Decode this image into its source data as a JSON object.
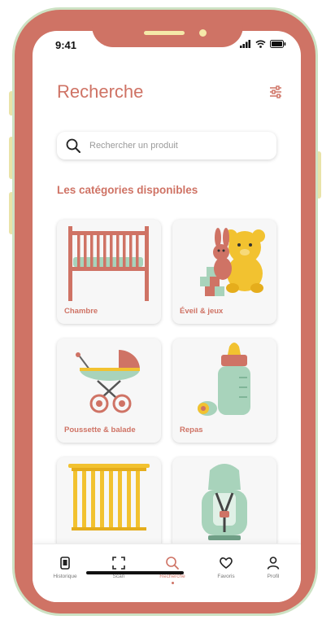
{
  "status_bar": {
    "time": "9:41"
  },
  "header": {
    "title": "Recherche"
  },
  "search": {
    "placeholder": "Rechercher un produit"
  },
  "section": {
    "title": "Les catégories disponibles"
  },
  "categories": [
    {
      "label": "Chambre",
      "icon": "crib-icon"
    },
    {
      "label": "Éveil & jeux",
      "icon": "teddy-bear-icon"
    },
    {
      "label": "Poussette & balade",
      "icon": "stroller-icon"
    },
    {
      "label": "Repas",
      "icon": "baby-bottle-icon"
    },
    {
      "label": "",
      "icon": "safety-gate-icon"
    },
    {
      "label": "",
      "icon": "car-seat-icon"
    }
  ],
  "tabbar": [
    {
      "label": "Historique",
      "icon": "history-icon"
    },
    {
      "label": "Scan",
      "icon": "scan-icon"
    },
    {
      "label": "Recherche",
      "icon": "search-icon",
      "active": true
    },
    {
      "label": "Favoris",
      "icon": "heart-icon"
    },
    {
      "label": "Profil",
      "icon": "user-icon"
    }
  ],
  "colors": {
    "brand": "#cf7365",
    "mint": "#a8d3bb",
    "yellow": "#f2c230",
    "frame_outline": "#cde2c4"
  }
}
